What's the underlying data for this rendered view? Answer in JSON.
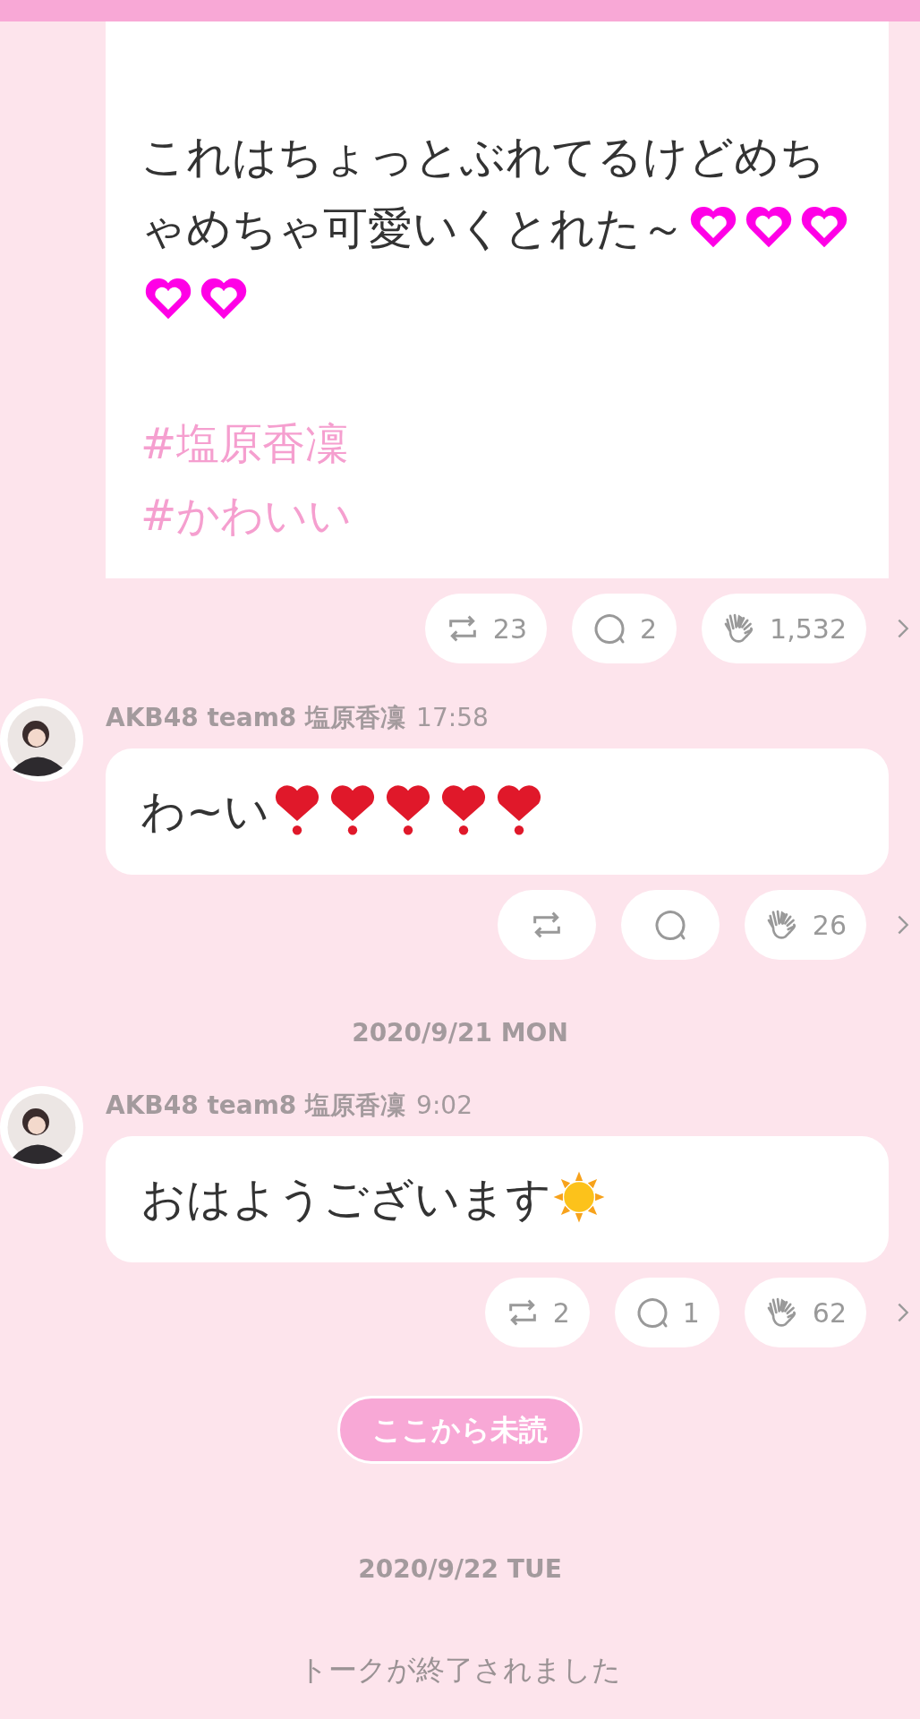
{
  "messages": [
    {
      "kind": "continued",
      "parts": [
        {
          "kind": "text",
          "text": "これはちょっとぶれてるけどめちゃめちゃ可愛いくとれた～"
        },
        {
          "kind": "glowing-heart"
        },
        {
          "kind": "glowing-heart"
        },
        {
          "kind": "glowing-heart"
        },
        {
          "kind": "glowing-heart"
        },
        {
          "kind": "glowing-heart"
        }
      ],
      "hashtags": [
        "#塩原香凜",
        "#かわいい"
      ],
      "reactions": {
        "reposts": "23",
        "comments": "2",
        "claps": "1,532"
      }
    },
    {
      "kind": "post",
      "author": "AKB48 team8 塩原香凜",
      "time": "17:58",
      "parts": [
        {
          "kind": "text",
          "text": "わ~い"
        },
        {
          "kind": "exclamation-heart"
        },
        {
          "kind": "exclamation-heart"
        },
        {
          "kind": "exclamation-heart"
        },
        {
          "kind": "exclamation-heart"
        },
        {
          "kind": "exclamation-heart"
        }
      ],
      "reactions": {
        "claps": "26"
      }
    },
    {
      "kind": "date",
      "text": "2020/9/21 MON"
    },
    {
      "kind": "post",
      "author": "AKB48 team8 塩原香凜",
      "time": "9:02",
      "parts": [
        {
          "kind": "text",
          "text": "おはようございます"
        },
        {
          "kind": "sun"
        }
      ],
      "reactions": {
        "reposts": "2",
        "comments": "1",
        "claps": "62"
      }
    },
    {
      "kind": "unread",
      "text": "ここから未読"
    },
    {
      "kind": "date",
      "text": "2020/9/22 TUE"
    },
    {
      "kind": "notice",
      "text": "トークが終了されました"
    }
  ]
}
